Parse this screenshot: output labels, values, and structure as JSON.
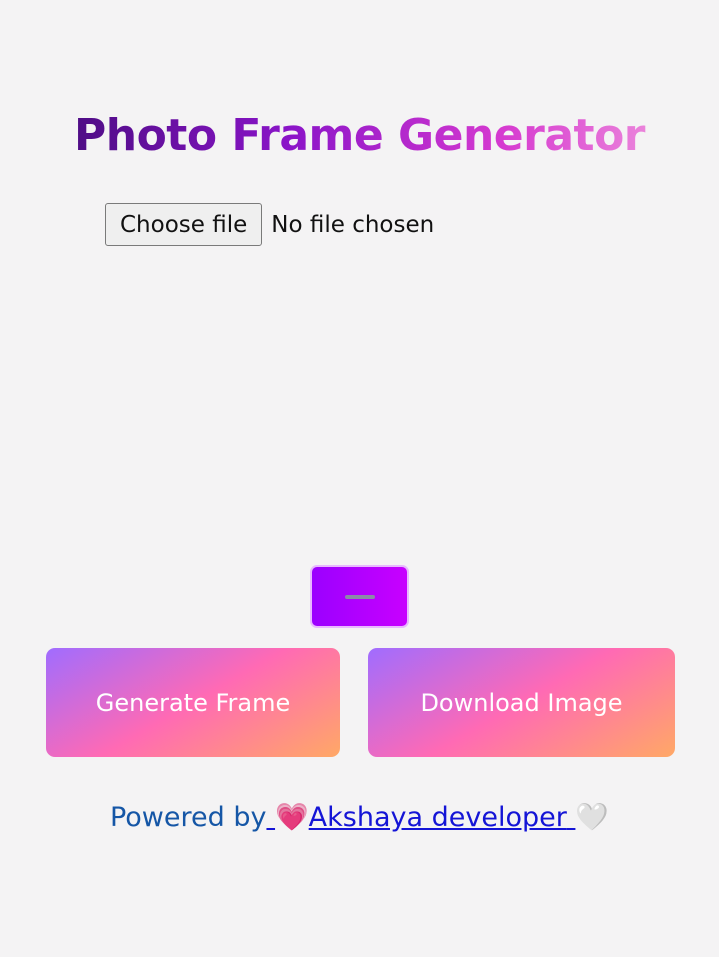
{
  "title": "Photo Frame Generator",
  "file_input": {
    "button_label": "Choose file",
    "status": "No file chosen"
  },
  "frame_toggle": {
    "icon": "minus-icon"
  },
  "actions": {
    "generate_label": "Generate Frame",
    "download_label": "Download Image"
  },
  "footer": {
    "prefix": "Powered by",
    "link_text": "Akshaya developer",
    "heart_left": "💗",
    "heart_right": "🤍"
  },
  "colors": {
    "background": "#f4f3f4",
    "title_gradient": [
      "#3a0a6e",
      "#8a14c8",
      "#d63ad0",
      "#f5a8e0"
    ],
    "button_gradient": [
      "#a06cff",
      "#ff6ab4",
      "#ffa866"
    ],
    "toggle_gradient": [
      "#9b00ff",
      "#c800ff"
    ],
    "footer_prefix": "#1556a6",
    "footer_link": "#1414d6"
  }
}
